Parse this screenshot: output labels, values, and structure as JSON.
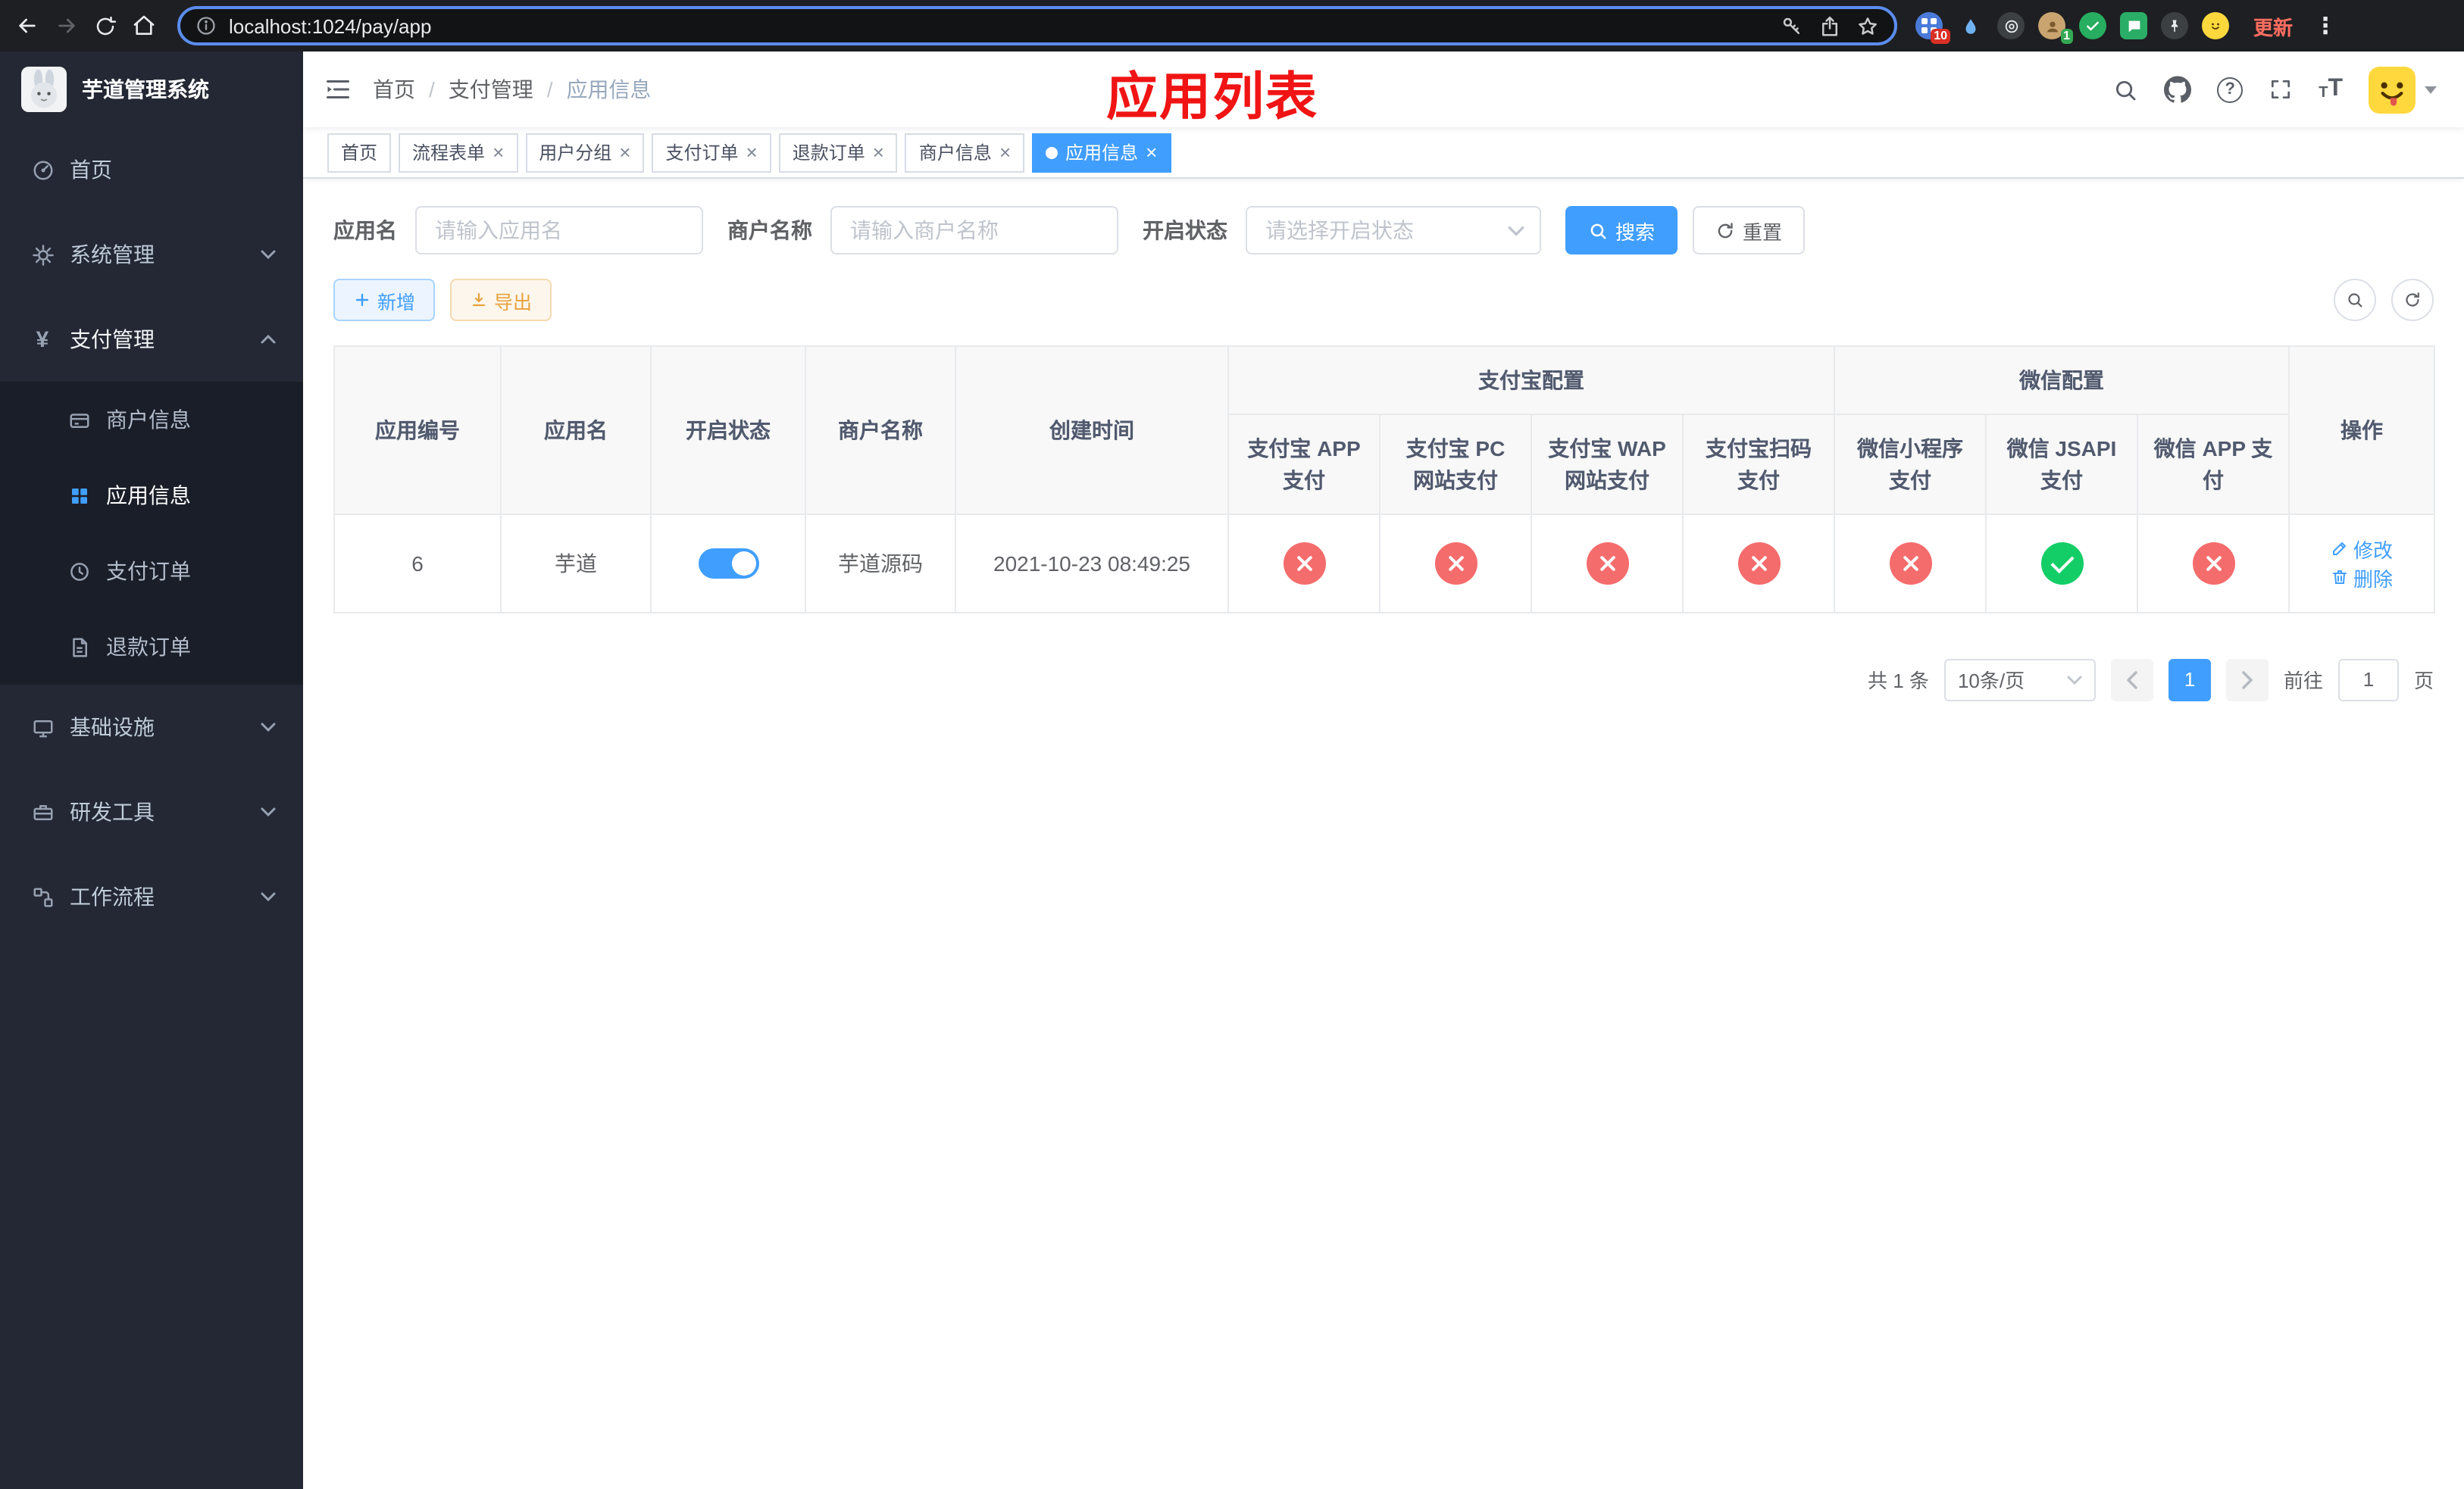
{
  "browser": {
    "url": "localhost:1024/pay/app",
    "update_label": "更新",
    "ext_badge_1": "10",
    "ext_badge_2": "1"
  },
  "icons": {
    "close": "×",
    "help": "?",
    "menu_dots": "⋮",
    "yen": "¥",
    "font_big": "T",
    "font_small": "T",
    "breadcrumb_separator": "/"
  },
  "sidebar": {
    "title": "芋道管理系统",
    "items": [
      {
        "label": "首页"
      },
      {
        "label": "系统管理"
      },
      {
        "label": "支付管理"
      },
      {
        "label": "基础设施"
      },
      {
        "label": "研发工具"
      },
      {
        "label": "工作流程"
      }
    ],
    "payment_children": [
      {
        "label": "商户信息"
      },
      {
        "label": "应用信息"
      },
      {
        "label": "支付订单"
      },
      {
        "label": "退款订单"
      }
    ]
  },
  "navbar": {
    "breadcrumb": [
      "首页",
      "支付管理",
      "应用信息"
    ]
  },
  "overlay_title": "应用列表",
  "tags": [
    {
      "label": "首页"
    },
    {
      "label": "流程表单"
    },
    {
      "label": "用户分组"
    },
    {
      "label": "支付订单"
    },
    {
      "label": "退款订单"
    },
    {
      "label": "商户信息"
    },
    {
      "label": "应用信息"
    }
  ],
  "filter": {
    "app_name_label": "应用名",
    "app_name_placeholder": "请输入应用名",
    "merchant_label": "商户名称",
    "merchant_placeholder": "请输入商户名称",
    "status_label": "开启状态",
    "status_placeholder": "请选择开启状态",
    "search_label": "搜索",
    "reset_label": "重置"
  },
  "toolbar": {
    "add_label": "新增",
    "export_label": "导出"
  },
  "table": {
    "headers": {
      "app_id": "应用编号",
      "app_name": "应用名",
      "status": "开启状态",
      "merchant": "商户名称",
      "create_time": "创建时间",
      "alipay_group": "支付宝配置",
      "wechat_group": "微信配置",
      "actions": "操作",
      "alipay_cols": [
        "支付宝 APP 支付",
        "支付宝 PC 网站支付",
        "支付宝 WAP 网站支付",
        "支付宝扫码支付"
      ],
      "wechat_cols": [
        "微信小程序支付",
        "微信 JSAPI 支付",
        "微信 APP 支付"
      ]
    },
    "row": {
      "app_id": "6",
      "app_name": "芋道",
      "status_on": true,
      "merchant": "芋道源码",
      "create_time": "2021-10-23 08:49:25",
      "configs": [
        false,
        false,
        false,
        false,
        false,
        true,
        false
      ],
      "edit_label": "修改",
      "delete_label": "删除"
    }
  },
  "pagination": {
    "total": "共 1 条",
    "page_size": "10条/页",
    "current_page": "1",
    "goto_label": "前往",
    "goto_value": "1",
    "page_unit": "页"
  },
  "colors": {
    "primary": "#409EFF",
    "success": "#13ce66",
    "danger": "#f56c6c",
    "active_tag": "#409EFF"
  }
}
